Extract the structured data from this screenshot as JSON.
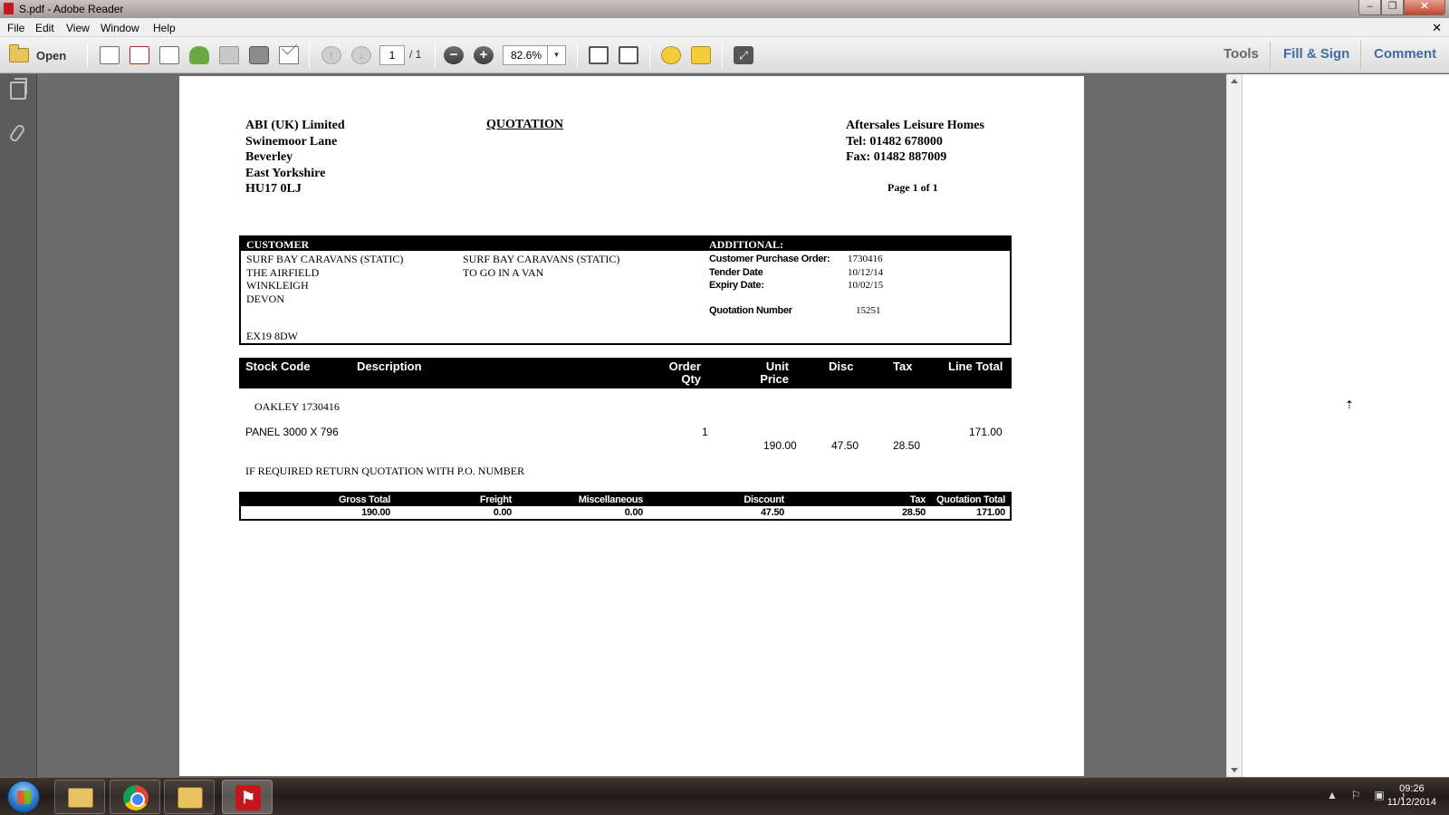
{
  "window": {
    "title": "S.pdf - Adobe Reader"
  },
  "menu": [
    "File",
    "Edit",
    "View",
    "Window",
    "Help"
  ],
  "toolbar": {
    "open_label": "Open",
    "page_current": "1",
    "page_total": "/ 1",
    "zoom": "82.6%",
    "tools_label": "Tools",
    "fill_sign_label": "Fill & Sign",
    "comment_label": "Comment"
  },
  "doc": {
    "company": [
      "ABI (UK) Limited",
      "Swinemoor Lane",
      "Beverley",
      "East Yorkshire",
      "HU17 0LJ"
    ],
    "heading": "QUOTATION",
    "supplier": [
      "Aftersales Leisure Homes",
      "Tel: 01482 678000",
      "Fax: 01482 887009"
    ],
    "page_no": "Page 1 of 1",
    "customer_header": "CUSTOMER",
    "additional_header": "ADDITIONAL:",
    "customer_addr": [
      "SURF BAY CARAVANS (STATIC)",
      "THE AIRFIELD",
      "WINKLEIGH",
      "DEVON"
    ],
    "customer_postcode": "EX19 8DW",
    "delivery_addr": [
      "SURF BAY CARAVANS (STATIC)",
      "TO GO IN A VAN"
    ],
    "additional": {
      "labels": [
        "Customer Purchase Order:",
        "Tender Date",
        "Expiry Date:"
      ],
      "values": [
        "1730416",
        "10/12/14",
        "10/02/15"
      ],
      "quote_number_label": "Quotation Number",
      "quote_number": "15251"
    },
    "line_headers": {
      "stock_code": "Stock Code",
      "description": "Description",
      "order": "Order",
      "qty": "Qty",
      "unit": "Unit",
      "price": "Price",
      "disc": "Disc",
      "tax": "Tax",
      "line_total": "Line Total"
    },
    "line_ref": "OAKLEY 1730416",
    "line": {
      "stock": "PANEL 3000 X 796",
      "qty": "1",
      "unit_price": "190.00",
      "disc": "47.50",
      "tax": "28.50",
      "line_total": "171.00"
    },
    "note": "IF REQUIRED RETURN QUOTATION WITH P.O. NUMBER",
    "totals": {
      "gross_label": "Gross Total",
      "gross": "190.00",
      "freight_label": "Freight",
      "freight": "0.00",
      "misc_label": "Miscellaneous",
      "misc": "0.00",
      "discount_label": "Discount",
      "discount": "47.50",
      "tax_label": "Tax",
      "tax": "28.50",
      "quote_total_label": "Quotation Total",
      "quote_total": "171.00"
    }
  },
  "taskbar": {
    "time": "09:26",
    "date": "11/12/2014"
  }
}
